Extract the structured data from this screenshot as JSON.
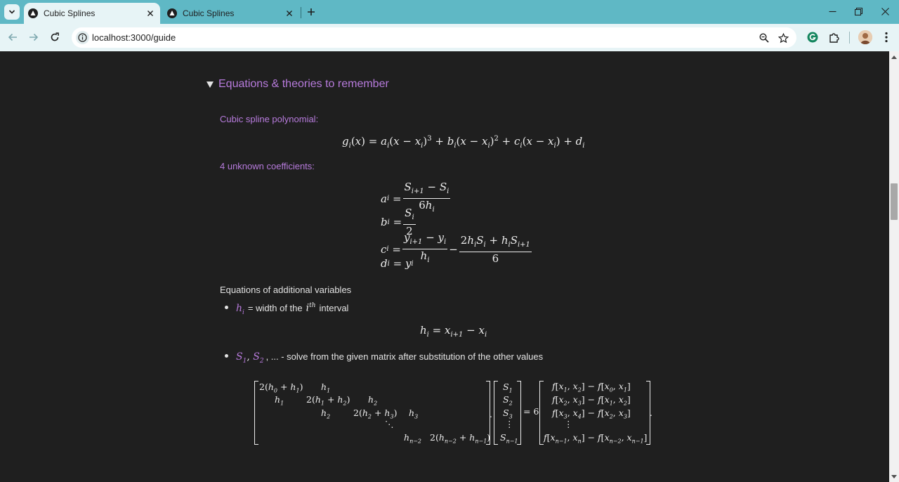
{
  "browser": {
    "tabs": [
      {
        "title": "Cubic Splines",
        "active": true
      },
      {
        "title": "Cubic Splines",
        "active": false
      }
    ],
    "url": "localhost:3000/guide"
  },
  "page": {
    "summary_title": "Equations & theories to remember",
    "cubic_label": "Cubic spline polynomial:",
    "coeff_label": "4 unknown coefficients:",
    "additional_label": "Equations of additional variables",
    "h_bullet_text_1": "= width of the",
    "h_bullet_text_2": "interval",
    "s_bullet_text": ", ... - solve from the given matrix after substitution of the other values"
  },
  "colors": {
    "accent_purple": "#b77bdc",
    "page_background": "#1f1f1f",
    "tab_strip": "#5fb8c5"
  },
  "icons": [
    "tab-search-icon",
    "browser-favicon",
    "close-icon",
    "new-tab-icon",
    "minimize-icon",
    "restore-icon",
    "back-icon",
    "forward-icon",
    "reload-icon",
    "site-info-icon",
    "zoom-icon",
    "bookmark-star-icon",
    "grammarly-icon",
    "extensions-icon",
    "avatar",
    "more-menu-icon"
  ]
}
